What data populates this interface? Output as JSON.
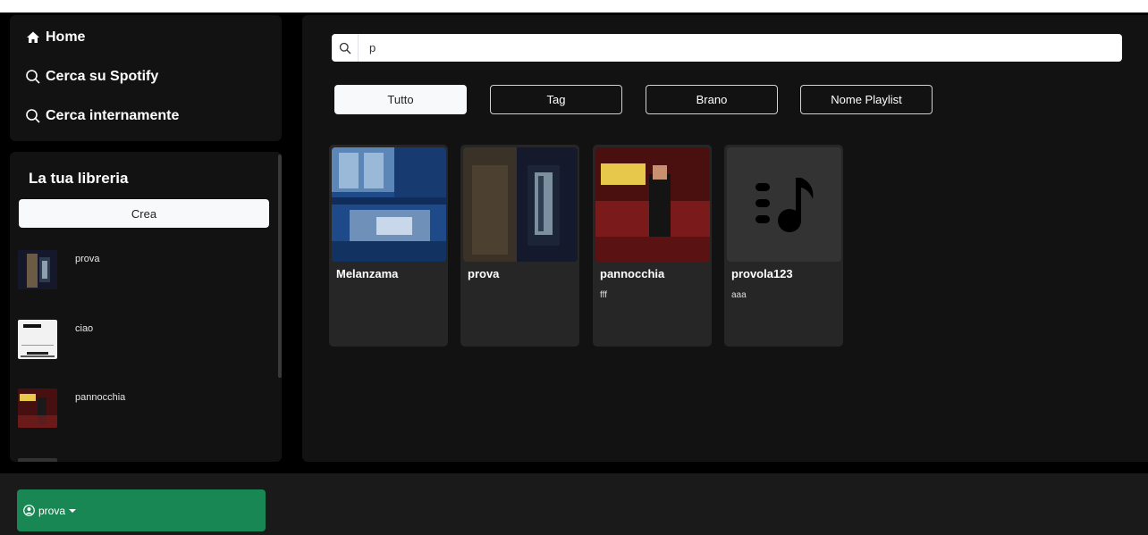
{
  "nav": {
    "home": {
      "label": "Home",
      "icon": "home-icon"
    },
    "spotify_search": {
      "label": "Cerca su Spotify",
      "icon": "search-icon"
    },
    "internal_search": {
      "label": "Cerca internamente",
      "icon": "search-icon"
    }
  },
  "library": {
    "title": "La tua libreria",
    "create_label": "Crea",
    "items": [
      {
        "label": "prova",
        "icon": "playlist-cover-door"
      },
      {
        "label": "ciao",
        "icon": "playlist-cover-seven"
      },
      {
        "label": "pannocchia",
        "icon": "playlist-cover-elvis"
      }
    ]
  },
  "search": {
    "value": "p",
    "placeholder": ""
  },
  "filters": [
    {
      "label": "Tutto",
      "active": true
    },
    {
      "label": "Tag",
      "active": false
    },
    {
      "label": "Brano",
      "active": false
    },
    {
      "label": "Nome Playlist",
      "active": false
    }
  ],
  "results": [
    {
      "title": "Melanzama",
      "subtitle": "",
      "icon": "album-cover-blue"
    },
    {
      "title": "prova",
      "subtitle": "",
      "icon": "album-cover-door"
    },
    {
      "title": "pannocchia",
      "subtitle": "fff",
      "icon": "album-cover-elvis"
    },
    {
      "title": "provola123",
      "subtitle": "aaa",
      "icon": "music-note-icon"
    }
  ],
  "user": {
    "name": "prova",
    "icon": "user-circle-icon"
  },
  "colors": {
    "accent": "#198754",
    "panel": "#121212",
    "card": "#262626"
  }
}
